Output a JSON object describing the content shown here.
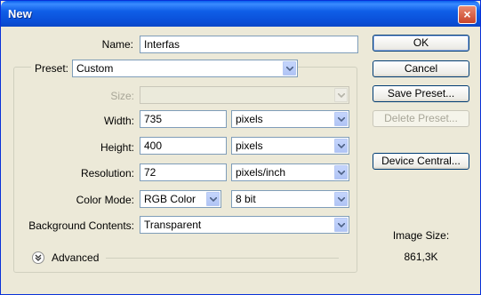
{
  "dialog": {
    "title": "New",
    "close_glyph": "×"
  },
  "name": {
    "label": "Name:",
    "value": "Interfas"
  },
  "preset": {
    "label": "Preset:",
    "value": "Custom"
  },
  "size": {
    "label": "Size:",
    "value": ""
  },
  "width": {
    "label": "Width:",
    "value": "735",
    "unit": "pixels"
  },
  "height": {
    "label": "Height:",
    "value": "400",
    "unit": "pixels"
  },
  "resolution": {
    "label": "Resolution:",
    "value": "72",
    "unit": "pixels/inch"
  },
  "color_mode": {
    "label": "Color Mode:",
    "value": "RGB Color",
    "depth": "8 bit"
  },
  "background": {
    "label": "Background Contents:",
    "value": "Transparent"
  },
  "advanced": {
    "label": "Advanced"
  },
  "buttons": {
    "ok": "OK",
    "cancel": "Cancel",
    "save_preset": "Save Preset...",
    "delete_preset": "Delete Preset...",
    "device_central": "Device Central..."
  },
  "image_size": {
    "label": "Image Size:",
    "value": "861,3K"
  },
  "icons": {
    "dropdown": "chevron-down-icon",
    "advanced": "double-chevron-down-icon",
    "close": "close-icon"
  },
  "colors": {
    "titlebar": "#0a4fd8",
    "dialog_bg": "#ece9d8",
    "field_border": "#7f9db9",
    "close": "#c8442a"
  }
}
